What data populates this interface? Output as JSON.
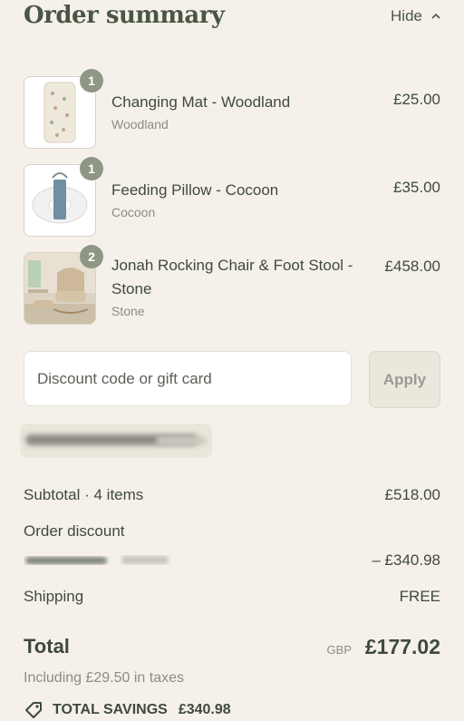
{
  "header": {
    "title": "Order summary",
    "toggle_label": "Hide"
  },
  "items": [
    {
      "name": "Changing Mat - Woodland",
      "variant": "Woodland",
      "price": "£25.00",
      "quantity": "1"
    },
    {
      "name": "Feeding Pillow - Cocoon",
      "variant": "Cocoon",
      "price": "£35.00",
      "quantity": "1"
    },
    {
      "name": "Jonah Rocking Chair & Foot Stool - Stone",
      "variant": "Stone",
      "price": "£458.00",
      "quantity": "2"
    }
  ],
  "discount": {
    "placeholder": "Discount code or gift card",
    "apply_label": "Apply"
  },
  "summary": {
    "subtotal_label": "Subtotal · 4 items",
    "subtotal_value": "£518.00",
    "order_discount_label": "Order discount",
    "order_discount_value": "– £340.98",
    "shipping_label": "Shipping",
    "shipping_value": "FREE",
    "total_label": "Total",
    "total_currency": "GBP",
    "total_value": "£177.02",
    "taxes_note": "Including £29.50 in taxes",
    "savings_label": "TOTAL SAVINGS",
    "savings_value": "£340.98"
  },
  "colors": {
    "background": "#f5f1ea",
    "text": "#3f4a3a",
    "muted": "#8c8c83",
    "badge": "#8e9685"
  }
}
